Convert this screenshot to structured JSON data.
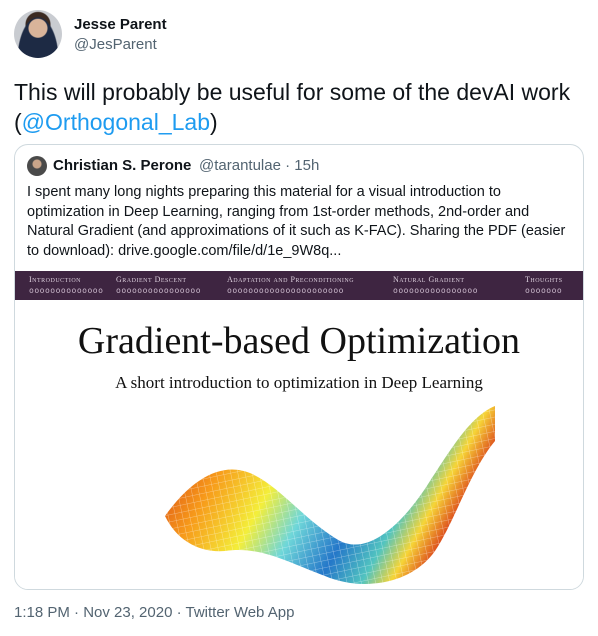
{
  "author": {
    "name": "Jesse Parent",
    "handle": "@JesParent"
  },
  "tweet": {
    "text_before": "This will probably be useful for some of the devAI work",
    "open_paren": "(",
    "mention": "@Orthogonal_Lab",
    "close_paren": ")"
  },
  "quoted": {
    "name": "Christian S. Perone",
    "meta": "@tarantulae · 15h",
    "text": "I spent many long nights preparing this material for a visual introduction to optimization in Deep Learning, ranging from 1st-order methods, 2nd-order and Natural Gradient (and approximations of it such as K-FAC). Sharing the PDF (easier to download): drive.google.com/file/d/1e_9W8q..."
  },
  "slide": {
    "nav": [
      {
        "label": "Introduction",
        "dots": "oooooooooooooo"
      },
      {
        "label": "Gradient Descent",
        "dots": "oooooooooooooooo"
      },
      {
        "label": "Adaptation and Preconditioning",
        "dots": "oooooooooooooooooooooo"
      },
      {
        "label": "Natural Gradient",
        "dots": "oooooooooooooooo"
      },
      {
        "label": "Thoughts",
        "dots": "ooooooo"
      }
    ],
    "title": "Gradient-based Optimization",
    "subtitle": "A short introduction to optimization in Deep Learning"
  },
  "footer": {
    "meta": "1:18 PM · Nov 23, 2020 · Twitter Web App"
  },
  "colors": {
    "mention": "#1d9bf0",
    "nav_bg": "#3e2541"
  }
}
